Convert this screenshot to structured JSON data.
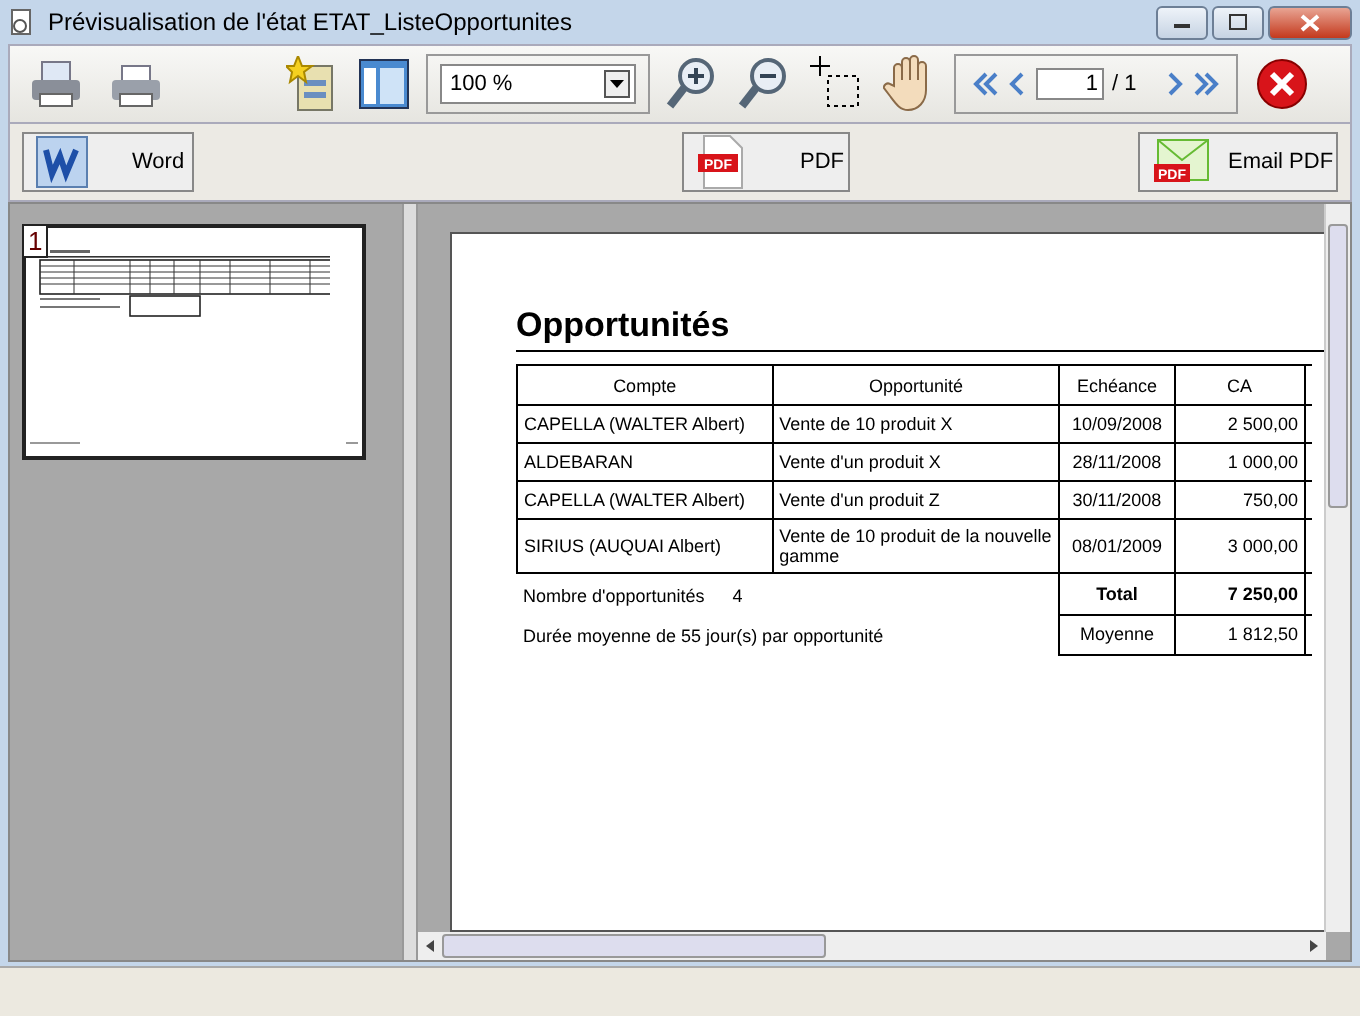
{
  "window": {
    "title": "Prévisualisation de l'état ETAT_ListeOpportunites"
  },
  "toolbar": {
    "zoom": "100 %",
    "page": "1",
    "page_total": "/ 1"
  },
  "export_buttons": [
    {
      "kind": "word",
      "label": "Word"
    },
    {
      "kind": "pdf",
      "label": "PDF",
      "icon_text": "PDF"
    },
    {
      "kind": "email",
      "label": "Email PDF",
      "icon_text": "PDF"
    }
  ],
  "thumbnail": {
    "page_number": "1"
  },
  "report": {
    "title": "Opportunités",
    "columns": [
      "Compte",
      "Opportunité",
      "Echéance",
      "CA"
    ],
    "rows": [
      [
        "CAPELLA (WALTER Albert)",
        "Vente de 10 produit X",
        "10/09/2008",
        "2 500,00"
      ],
      [
        "ALDEBARAN",
        "Vente d'un produit X",
        "28/11/2008",
        "1 000,00"
      ],
      [
        "CAPELLA (WALTER Albert)",
        "Vente d'un produit Z",
        "30/11/2008",
        "750,00"
      ],
      [
        "SIRIUS (AUQUAI Albert)",
        "Vente de 10 produit de la nouvelle gamme",
        "08/01/2009",
        "3 000,00"
      ]
    ],
    "count_label": "Nombre d'opportunités",
    "count": "4",
    "total_label": "Total",
    "total": "7 250,00",
    "duration": "Durée moyenne de 55 jour(s) par opportunité",
    "average_label": "Moyenne",
    "average": "1 812,50"
  }
}
